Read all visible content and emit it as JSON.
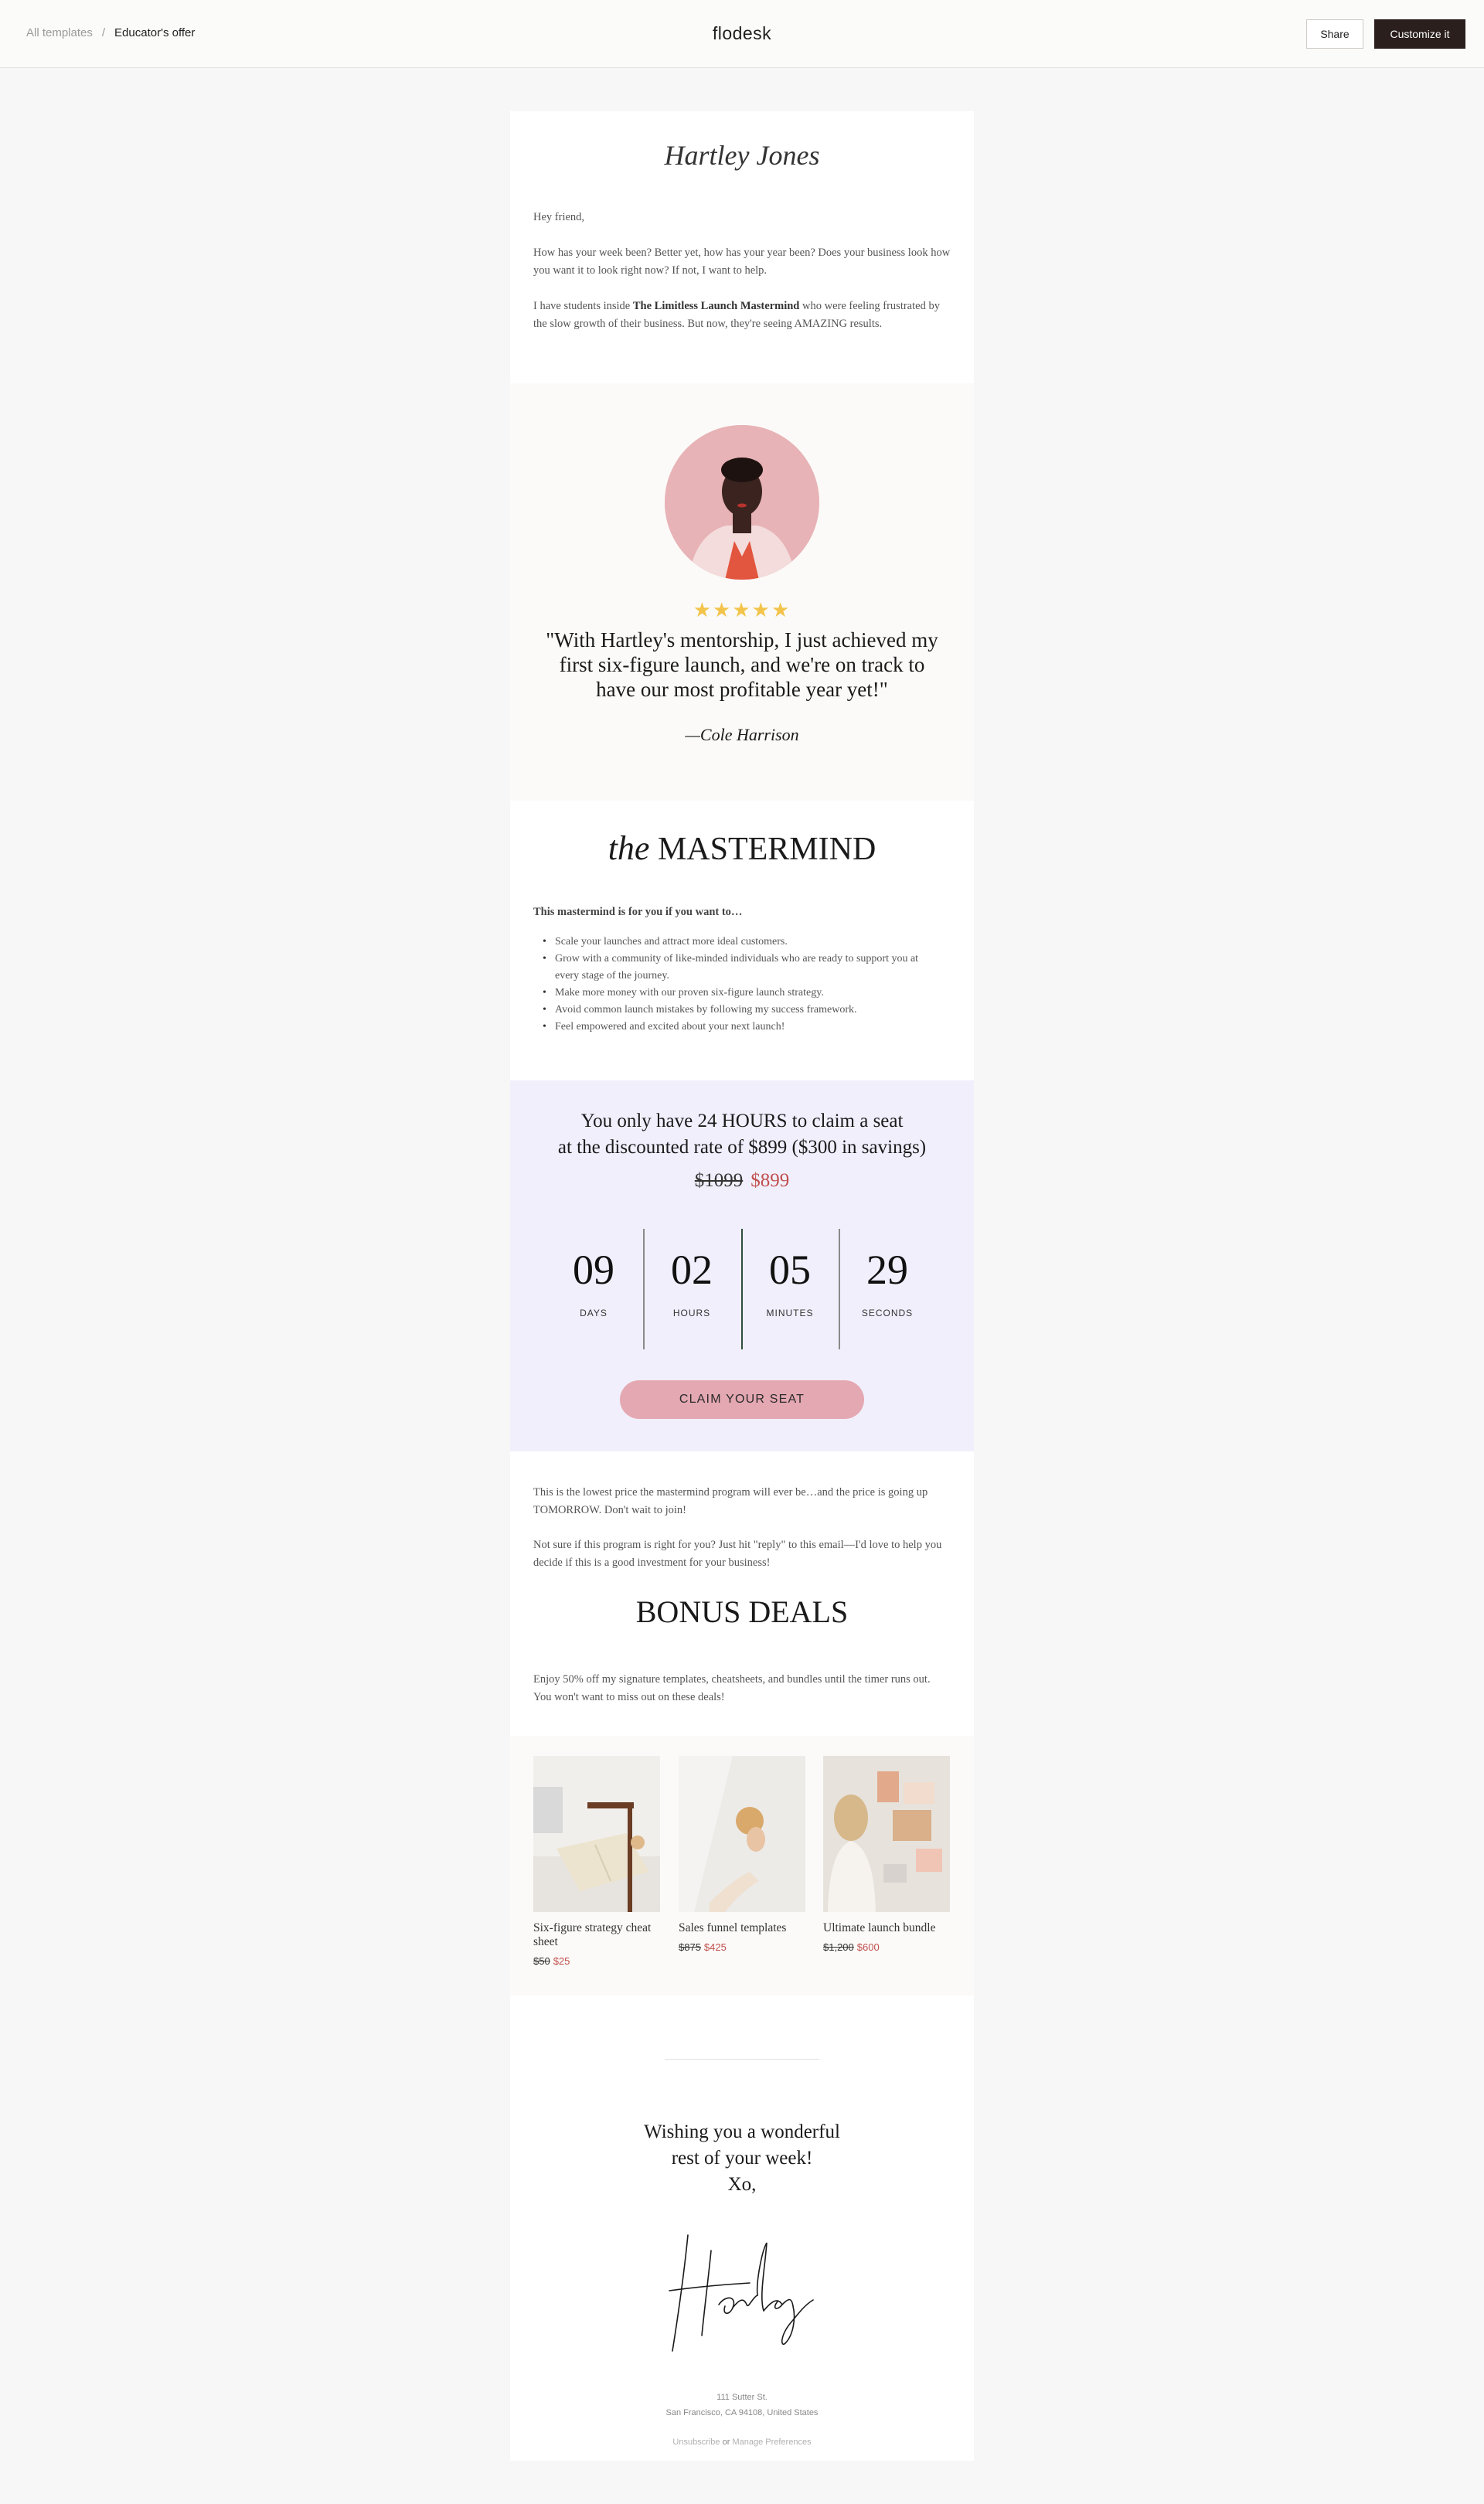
{
  "topbar": {
    "crumb_root": "All templates",
    "crumb_sep": "/",
    "crumb_current": "Educator's offer",
    "logo": "flodesk",
    "share_label": "Share",
    "customize_label": "Customize it"
  },
  "email": {
    "brand_name": "Hartley Jones",
    "intro": {
      "greeting": "Hey friend,",
      "p1": "How has your week been? Better yet, how has your year been? Does your business look how you want it to look right now? If not, I want to help.",
      "p2_a": "I have students inside ",
      "p2_bold": "The Limitless Launch Mastermind",
      "p2_b": " who were feeling frustrated by the slow growth of their business. But now, they're seeing AMAZING results."
    },
    "testimonial": {
      "stars": "★★★★★",
      "quote": "\"With Hartley's mentorship, I just achieved my first six-figure launch, and we're on track to have our most profitable year yet!\"",
      "author": "—Cole Harrison"
    },
    "mastermind": {
      "heading_italic": "the",
      "heading": "MASTERMIND",
      "list_title": "This mastermind is for you if you want to…",
      "items": [
        "Scale your launches and attract more ideal customers.",
        "Grow with a community of like-minded individuals who are ready to support you at every stage of the journey.",
        "Make more money with our proven six-figure launch strategy.",
        "Avoid common launch mistakes by following my success framework.",
        "Feel empowered and excited about your next launch!"
      ]
    },
    "offer": {
      "line1": "You only have 24 HOURS to claim a seat",
      "line2": "at the discounted rate of $899 ($300 in savings)",
      "old_price": "$1099",
      "new_price": "$899",
      "countdown": [
        {
          "value": "09",
          "label": "DAYS"
        },
        {
          "value": "02",
          "label": "HOURS"
        },
        {
          "value": "05",
          "label": "MINUTES"
        },
        {
          "value": "29",
          "label": "SECONDS"
        }
      ],
      "cta": "CLAIM YOUR SEAT"
    },
    "body2": {
      "p1": "This is the lowest price the mastermind program will ever be…and the price is going up TOMORROW. Don't wait to join!",
      "p2": "Not sure if this program is right for you? Just hit \"reply\" to this email—I'd love to help you decide if this is a good investment for your business!",
      "bonus_heading": "BONUS DEALS",
      "bonus_text": "Enjoy 50% off my signature templates, cheatsheets, and bundles until the timer runs out. You won't want to miss out on these deals!"
    },
    "products": [
      {
        "name": "Six-figure strategy cheat sheet",
        "old": "$50",
        "new": "$25"
      },
      {
        "name": "Sales funnel templates",
        "old": "$875",
        "new": "$425"
      },
      {
        "name": "Ultimate launch bundle",
        "old": "$1,200",
        "new": "$600"
      }
    ],
    "closing": {
      "line1": "Wishing you a wonderful",
      "line2": "rest of your week!",
      "line3": "Xo,",
      "signature": "Harley",
      "address1": "111 Sutter St.",
      "address2": "San Francisco, CA 94108, United States",
      "unsubscribe": "Unsubscribe",
      "or": "or",
      "manage": "Manage Preferences"
    }
  },
  "colors": {
    "accent_pink": "#e4a8b2",
    "sale_red": "#c0504d",
    "lavender_bg": "#f1effc",
    "cream_bg": "#fbfaf8",
    "star_yellow": "#f3c44b",
    "dark_button": "#2a1f1d"
  }
}
